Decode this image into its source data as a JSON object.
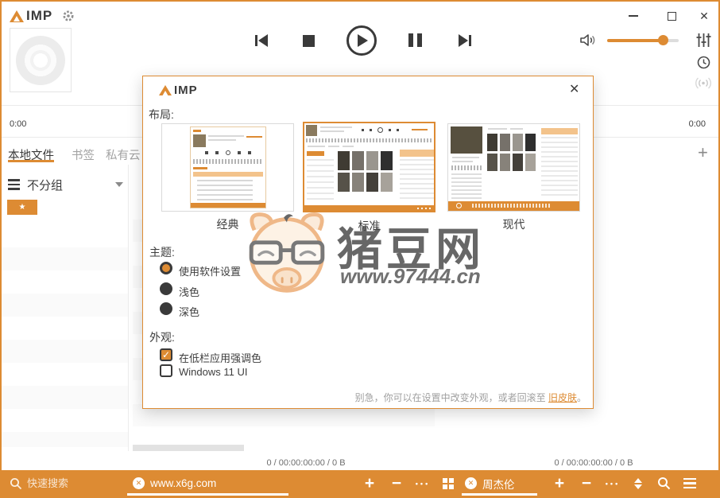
{
  "titlebar": {
    "logo": "IMP"
  },
  "player": {
    "time_left": "0:00",
    "time_right": "0:00"
  },
  "tabs": {
    "items": [
      {
        "label": "本地文件",
        "active": true
      },
      {
        "label": "书签",
        "active": false
      },
      {
        "label": "私有云",
        "active": false
      }
    ]
  },
  "playlist": {
    "group_label": "不分组"
  },
  "status": {
    "left": "0 / 00:00:00:00 / 0 B",
    "right": "0 / 00:00:00:00 / 0 B"
  },
  "bottombar": {
    "search_placeholder": "快速搜索",
    "tab1": "www.x6g.com",
    "tab2": "周杰伦"
  },
  "dialog": {
    "logo": "IMP",
    "layout_label": "布局:",
    "layouts": [
      {
        "label": "经典",
        "selected": false
      },
      {
        "label": "标准",
        "selected": true
      },
      {
        "label": "现代",
        "selected": false
      }
    ],
    "theme_label": "主题:",
    "theme_options": [
      {
        "label": "使用软件设置",
        "selected": true
      },
      {
        "label": "浅色",
        "selected": false
      },
      {
        "label": "深色",
        "selected": false
      }
    ],
    "appearance_label": "外观:",
    "appearance_options": [
      {
        "label": "在低栏应用强调色",
        "checked": true
      },
      {
        "label": "Windows 11 UI",
        "checked": false
      }
    ],
    "footer": {
      "text": "别急，你可以在设置中改变外观，或者回滚至 ",
      "link": "旧皮肤",
      "suffix": "。"
    }
  },
  "watermark": {
    "title": "猪豆网",
    "url": "www.97444.cn"
  },
  "icons": {
    "star": "★",
    "plus": "+",
    "minus": "−",
    "ellipsis": "•••",
    "close": "✕",
    "check": "✓"
  },
  "colors": {
    "accent": "#DD8B33",
    "dark": "#3d3d3d"
  }
}
